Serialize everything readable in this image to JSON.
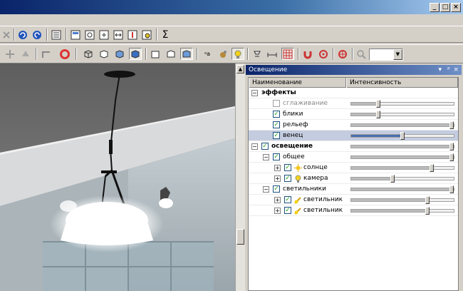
{
  "window": {
    "controls": [
      "_",
      "□",
      "×"
    ]
  },
  "toolbar1": {
    "icons": [
      "close-icon",
      "undo-icon",
      "redo-icon",
      "properties-icon",
      "layout-icon",
      "zoom-window-icon",
      "fit-icon",
      "pan-icon",
      "target-icon",
      "print-preview-icon",
      "sigma-icon"
    ]
  },
  "toolbar2": {
    "icons": [
      "move-icon",
      "up-arrow-icon",
      "scene-icon",
      "lifebuoy-icon",
      "wireframe-cube-icon",
      "hidden-line-cube-icon",
      "shaded-cube-icon",
      "render-cube-icon",
      "box-front-icon",
      "box-side-icon",
      "box-blue-icon",
      "text-label-icon",
      "material-sphere-icon",
      "light-bulb-icon",
      "stamp-icon",
      "dimension-icon",
      "grid-icon",
      "magnet-icon",
      "snap-target-icon",
      "snap-center-icon",
      "zoom-icon"
    ],
    "zoom_value": ""
  },
  "panel": {
    "title": "Освещение",
    "title_buttons": [
      "▾",
      "ᵖ",
      "×"
    ],
    "columns": [
      "Наименование",
      "Интенсивность"
    ],
    "rows": [
      {
        "label": "эффекты",
        "level": 0,
        "expander": "−",
        "checkbox": null,
        "bold": true,
        "slider": null,
        "selected": false,
        "gray": false
      },
      {
        "label": "сглаживание",
        "level": 1,
        "expander": null,
        "checkbox": false,
        "bold": false,
        "slider": 0.25,
        "selected": false,
        "gray": true
      },
      {
        "label": "блики",
        "level": 1,
        "expander": null,
        "checkbox": true,
        "bold": false,
        "slider": 0.25,
        "selected": false,
        "gray": false
      },
      {
        "label": "рельеф",
        "level": 1,
        "expander": null,
        "checkbox": true,
        "bold": false,
        "slider": 1.0,
        "selected": false,
        "gray": false
      },
      {
        "label": "венец",
        "level": 1,
        "expander": null,
        "checkbox": true,
        "bold": false,
        "slider": 0.5,
        "selected": true,
        "gray": false
      },
      {
        "label": "освещение",
        "level": 0,
        "expander": "−",
        "checkbox": true,
        "bold": true,
        "slider": 1.0,
        "selected": false,
        "gray": false
      },
      {
        "label": "общее",
        "level": 1,
        "expander": "−",
        "checkbox": true,
        "bold": false,
        "slider": 1.0,
        "selected": false,
        "gray": false
      },
      {
        "label": "солнце",
        "level": 2,
        "expander": "+",
        "checkbox": true,
        "bold": false,
        "slider": 0.8,
        "selected": false,
        "gray": false,
        "icon": "sun-icon"
      },
      {
        "label": "камера",
        "level": 2,
        "expander": "+",
        "checkbox": true,
        "bold": false,
        "slider": 0.4,
        "selected": false,
        "gray": false,
        "icon": "bulb-icon"
      },
      {
        "label": "светильники",
        "level": 1,
        "expander": "−",
        "checkbox": true,
        "bold": false,
        "slider": 1.0,
        "selected": false,
        "gray": false
      },
      {
        "label": "светильник",
        "level": 2,
        "expander": "+",
        "checkbox": true,
        "bold": false,
        "slider": 0.75,
        "selected": false,
        "gray": false,
        "icon": "lamp-icon"
      },
      {
        "label": "светильник",
        "level": 2,
        "expander": "+",
        "checkbox": true,
        "bold": false,
        "slider": 0.75,
        "selected": false,
        "gray": false,
        "icon": "lamp-icon"
      }
    ]
  }
}
